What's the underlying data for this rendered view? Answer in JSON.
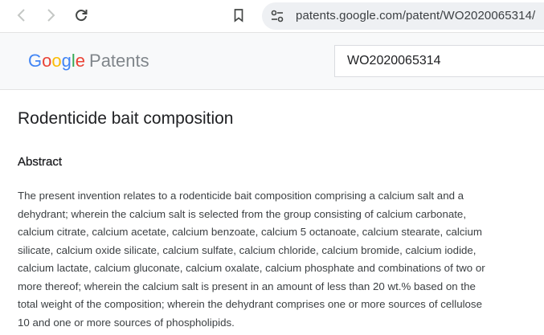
{
  "browser": {
    "url": "patents.google.com/patent/WO2020065314/",
    "icons": [
      "back-icon",
      "forward-icon",
      "reload-icon",
      "bookmark-icon",
      "site-settings-icon"
    ]
  },
  "header": {
    "logo_google": [
      "G",
      "o",
      "o",
      "g",
      "l",
      "e"
    ],
    "logo_product": "Patents",
    "search_value": "WO2020065314"
  },
  "patent": {
    "title": "Rodenticide bait composition",
    "abstract_heading": "Abstract",
    "abstract_lines": [
      "The present invention relates to a rodenticide bait composition comprising a calcium salt and a",
      "dehydrant; wherein the calcium salt is selected from the group consisting of calcium carbonate,",
      "calcium citrate, calcium acetate, calcium benzoate, calcium 5 octanoate, calcium stearate, calcium",
      "silicate, calcium oxide silicate, calcium sulfate, calcium chloride, calcium bromide, calcium iodide,",
      "calcium lactate, calcium gluconate, calcium oxalate, calcium phosphate and combinations of two or",
      "more thereof; wherein the calcium salt is present in an amount of less than 20 wt.% based on the",
      "total weight of the composition; wherein the dehydrant comprises one or more sources of cellulose",
      "10 and one or more sources of phospholipids."
    ]
  },
  "colors": {
    "google_blue": "#4285f4",
    "google_red": "#ea4335",
    "google_yellow": "#fbbc05",
    "google_green": "#34a853"
  }
}
